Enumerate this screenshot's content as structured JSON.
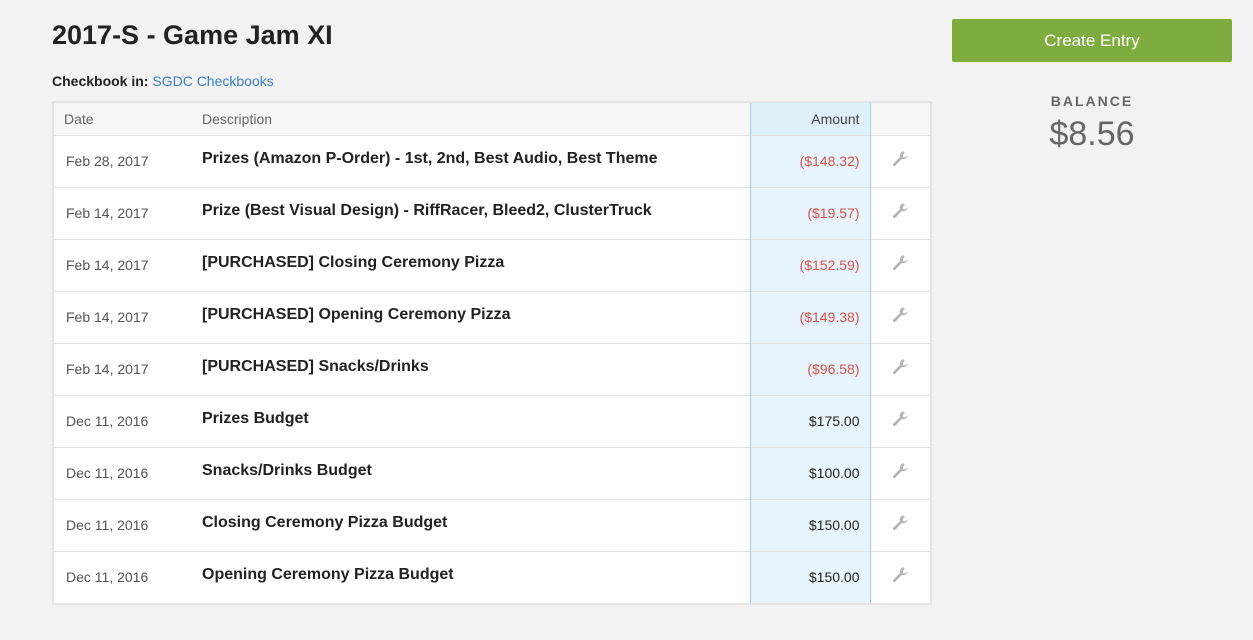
{
  "header": {
    "title": "2017-S - Game Jam XI",
    "checkbook_label": "Checkbook in:",
    "checkbook_link": "SGDC Checkbooks"
  },
  "table": {
    "columns": {
      "date": "Date",
      "description": "Description",
      "amount": "Amount"
    },
    "rows": [
      {
        "date": "Feb 28, 2017",
        "description": "Prizes (Amazon P-Order) - 1st, 2nd, Best Audio, Best Theme",
        "amount": "($148.32)",
        "negative": true
      },
      {
        "date": "Feb 14, 2017",
        "description": "Prize (Best Visual Design) - RiffRacer, Bleed2, ClusterTruck",
        "amount": "($19.57)",
        "negative": true
      },
      {
        "date": "Feb 14, 2017",
        "description": "[PURCHASED] Closing Ceremony Pizza",
        "amount": "($152.59)",
        "negative": true
      },
      {
        "date": "Feb 14, 2017",
        "description": "[PURCHASED] Opening Ceremony Pizza",
        "amount": "($149.38)",
        "negative": true
      },
      {
        "date": "Feb 14, 2017",
        "description": "[PURCHASED] Snacks/Drinks",
        "amount": "($96.58)",
        "negative": true
      },
      {
        "date": "Dec 11, 2016",
        "description": "Prizes Budget",
        "amount": "$175.00",
        "negative": false
      },
      {
        "date": "Dec 11, 2016",
        "description": "Snacks/Drinks Budget",
        "amount": "$100.00",
        "negative": false
      },
      {
        "date": "Dec 11, 2016",
        "description": "Closing Ceremony Pizza Budget",
        "amount": "$150.00",
        "negative": false
      },
      {
        "date": "Dec 11, 2016",
        "description": "Opening Ceremony Pizza Budget",
        "amount": "$150.00",
        "negative": false
      }
    ]
  },
  "sidebar": {
    "create_button": "Create Entry",
    "balance_label": "BALANCE",
    "balance_value": "$8.56"
  },
  "colors": {
    "accent_green": "#7fac3f",
    "link_blue": "#3a7ec9",
    "negative_red": "#d9534f",
    "amount_column_bg": "#e8f4fb"
  },
  "icons": {
    "row_action": "wrench-icon"
  }
}
